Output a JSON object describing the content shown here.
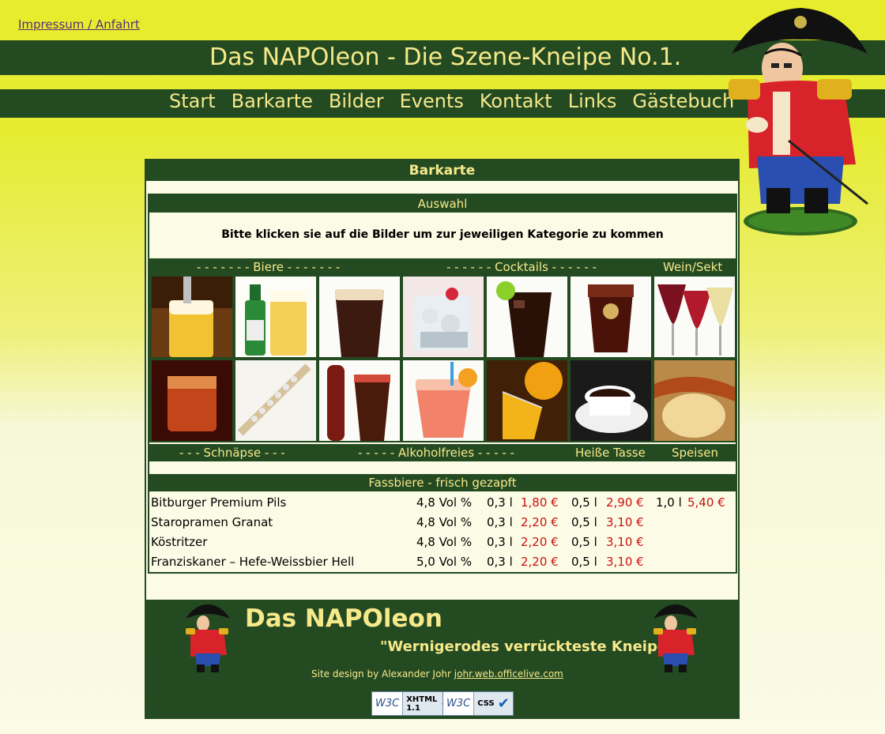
{
  "header": {
    "top_link": "Impressum / Anfahrt",
    "title": "Das NAPOleon - Die Szene-Kneipe No.1."
  },
  "nav": [
    "Start",
    "Barkarte",
    "Bilder",
    "Events",
    "Kontakt",
    "Links",
    "Gästebuch"
  ],
  "main": {
    "heading": "Barkarte",
    "selection_heading": "Auswahl",
    "instruction": "Bitte klicken sie auf die Bilder um zur jeweiligen Kategorie zu kommen",
    "categories_top": [
      "- - - - - - - Biere - - - - - - -",
      "- - - - - - Cocktails - - - - - -",
      "Wein/Sekt"
    ],
    "categories_bottom": [
      "- - - Schnäpse - - -",
      "- - - - - Alkoholfreies - - - - -",
      "Heiße Tasse",
      "Speisen"
    ]
  },
  "draft_beers": {
    "heading": "Fassbiere - frisch gezapft",
    "rows": [
      {
        "name": "Bitburger Premium Pils",
        "abv": "4,8 Vol %",
        "s1": "0,3 l",
        "p1": "1,80 €",
        "s2": "0,5 l",
        "p2": "2,90 €",
        "s3": "1,0 l",
        "p3": "5,40 €"
      },
      {
        "name": "Staropramen Granat",
        "abv": "4,8 Vol %",
        "s1": "0,3 l",
        "p1": "2,20 €",
        "s2": "0,5 l",
        "p2": "3,10 €",
        "s3": "",
        "p3": ""
      },
      {
        "name": "Köstritzer",
        "abv": "4,8 Vol %",
        "s1": "0,3 l",
        "p1": "2,20 €",
        "s2": "0,5 l",
        "p2": "3,10 €",
        "s3": "",
        "p3": ""
      },
      {
        "name": "Franziskaner – Hefe-Weissbier Hell",
        "abv": "5,0 Vol %",
        "s1": "0,3 l",
        "p1": "2,20 €",
        "s2": "0,5 l",
        "p2": "3,10 €",
        "s3": "",
        "p3": ""
      }
    ]
  },
  "footer": {
    "title": "Das NAPOleon",
    "slogan": "\"Wernigerodes verrückteste Kneipe\"",
    "credit": "Site design by Alexander Johr",
    "credit_link": "johr.web.officelive.com",
    "badge_xhtml_1": "XHTML",
    "badge_xhtml_2": "1.1",
    "badge_css": "CSS",
    "w3c": "W3C"
  },
  "colors": {
    "band": "#244a22",
    "gold": "#f6e98a",
    "price": "#cc1111"
  }
}
